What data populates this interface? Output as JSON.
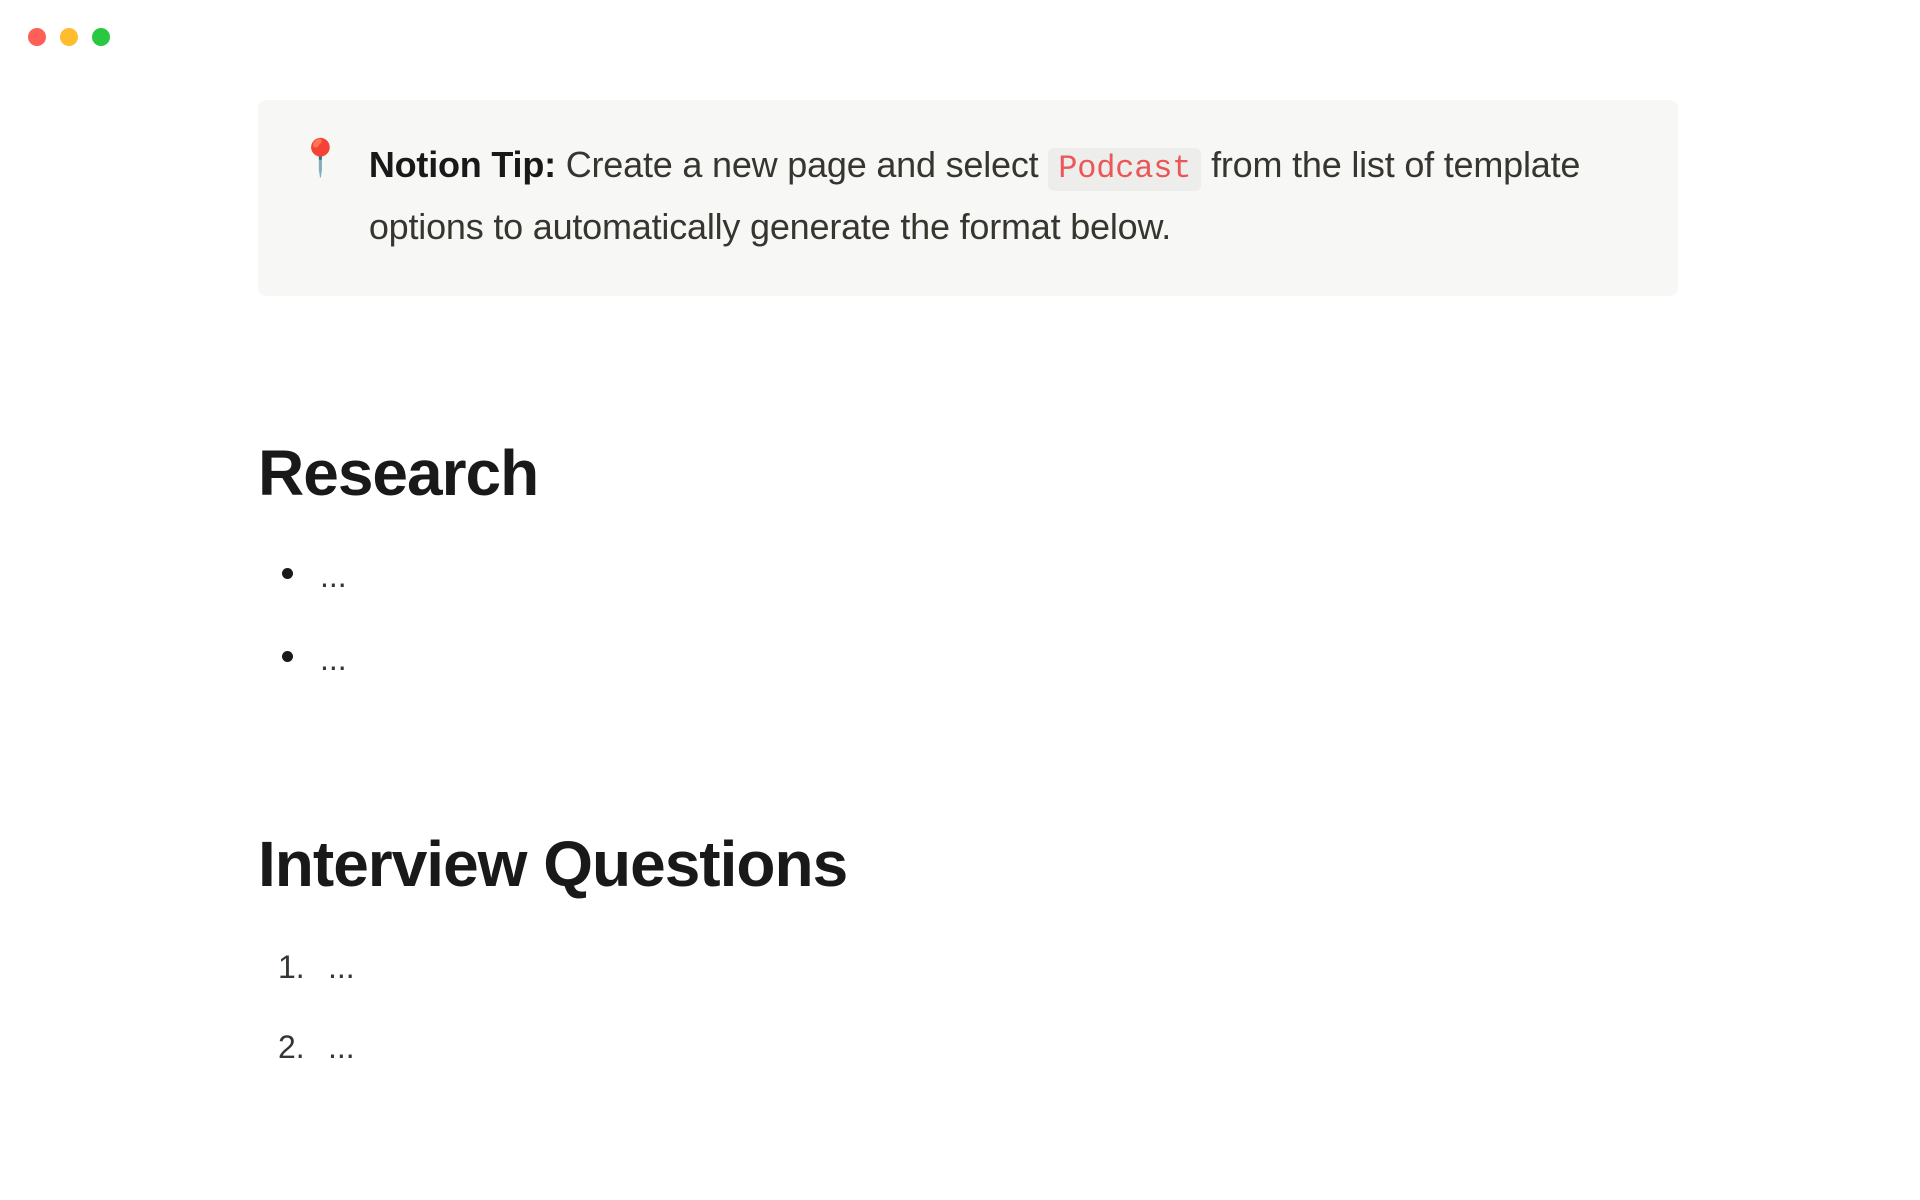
{
  "callout": {
    "icon": "📍",
    "tip_label": "Notion Tip:",
    "text_before": " Create a new page and select ",
    "code": "Podcast",
    "text_after": " from the list of template options to automatically generate the format below."
  },
  "sections": {
    "research": {
      "heading": "Research",
      "items": [
        "...",
        "..."
      ]
    },
    "interview_questions": {
      "heading": "Interview Questions",
      "items": [
        "...",
        "..."
      ]
    }
  }
}
